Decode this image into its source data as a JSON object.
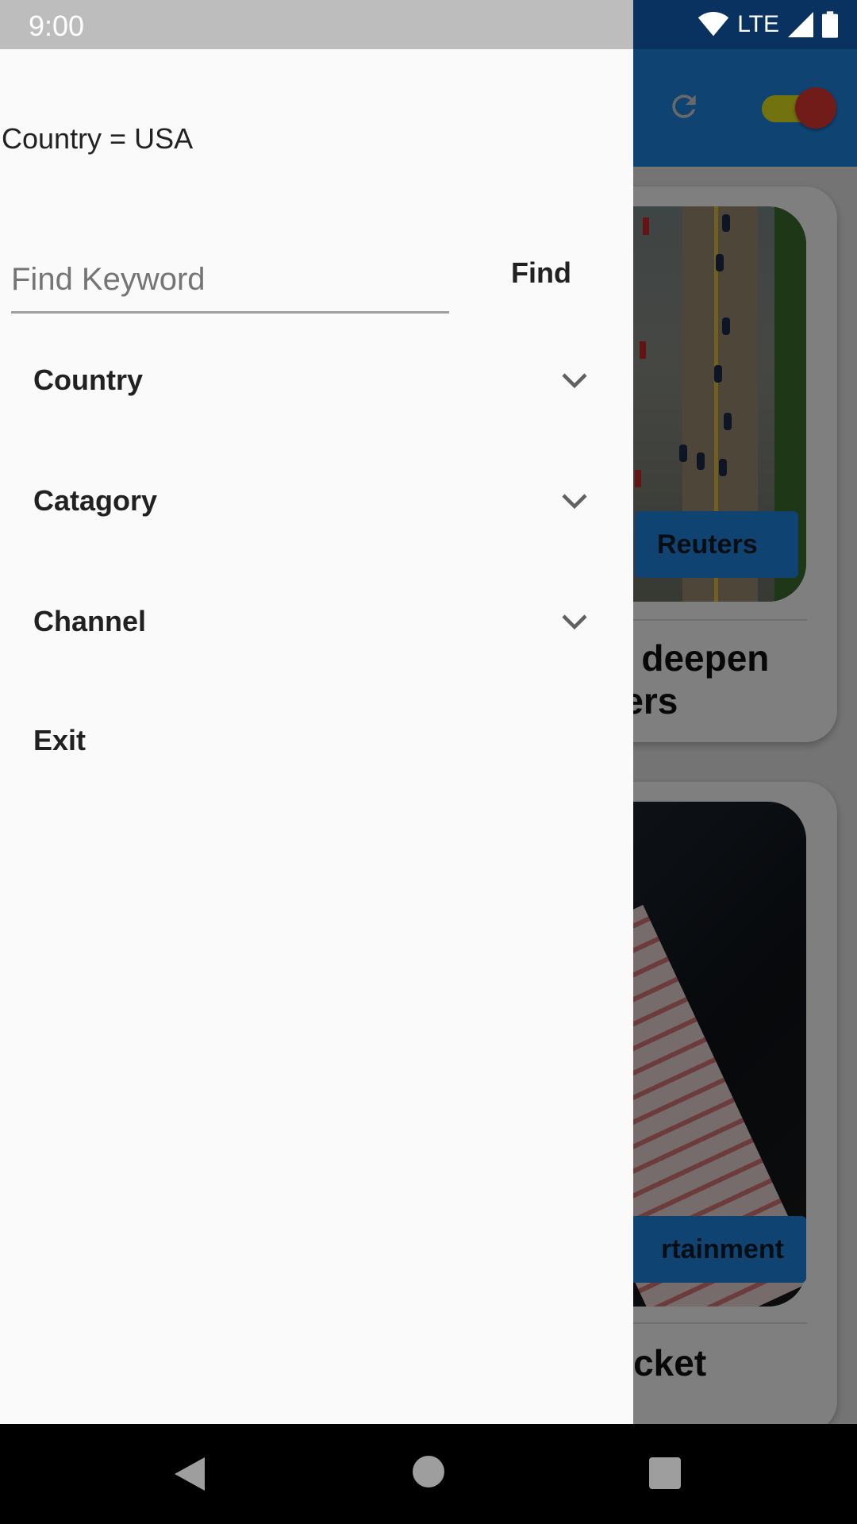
{
  "status_bar": {
    "time": "9:00",
    "network": "LTE"
  },
  "drawer": {
    "country_filter": "Country = USA",
    "search": {
      "placeholder": "Find Keyword",
      "value": "",
      "button_label": "Find"
    },
    "menu": [
      {
        "label": "Country",
        "icon": "chevron-down-icon"
      },
      {
        "label": "Catagory",
        "icon": "chevron-down-icon"
      },
      {
        "label": "Channel",
        "icon": "chevron-down-icon"
      },
      {
        "label": "Exit"
      }
    ]
  },
  "background_feed": {
    "cards": [
      {
        "source_tag": "Reuters",
        "headline_fragment": [
          "s deepen",
          "ters"
        ]
      },
      {
        "source_tag": "rtainment",
        "headline_fragment": [
          "ticket"
        ]
      }
    ]
  },
  "colors": {
    "app_bar": "#1e88e5",
    "toggle_track": "#e5e51f",
    "toggle_thumb": "#e53935",
    "drawer_bg": "#fafafa"
  }
}
